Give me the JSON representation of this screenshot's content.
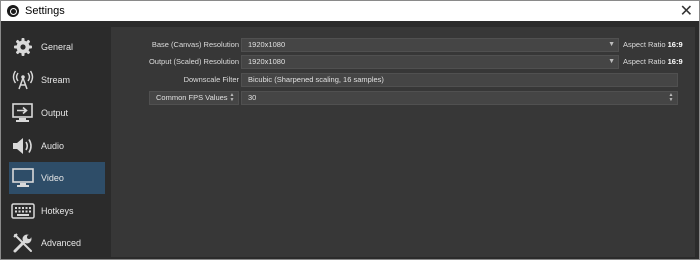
{
  "window": {
    "title": "Settings",
    "close_glyph": "✕"
  },
  "sidebar": {
    "items": [
      {
        "label": "General",
        "icon": "gear-icon",
        "active": false
      },
      {
        "label": "Stream",
        "icon": "antenna-icon",
        "active": false
      },
      {
        "label": "Output",
        "icon": "output-icon",
        "active": false
      },
      {
        "label": "Audio",
        "icon": "speaker-icon",
        "active": false
      },
      {
        "label": "Video",
        "icon": "monitor-icon",
        "active": true
      },
      {
        "label": "Hotkeys",
        "icon": "keyboard-icon",
        "active": false
      },
      {
        "label": "Advanced",
        "icon": "wrench-icon",
        "active": false
      }
    ]
  },
  "video": {
    "base_resolution": {
      "label": "Base (Canvas) Resolution",
      "value": "1920x1080",
      "aspect_label": "Aspect Ratio",
      "aspect_value": "16:9"
    },
    "output_resolution": {
      "label": "Output (Scaled) Resolution",
      "value": "1920x1080",
      "aspect_label": "Aspect Ratio",
      "aspect_value": "16:9"
    },
    "downscale_filter": {
      "label": "Downscale Filter",
      "value": "Bicubic (Sharpened scaling, 16 samples)"
    },
    "fps": {
      "type_value": "Common FPS Values",
      "value": "30"
    }
  },
  "colors": {
    "background": "#2b2b2b",
    "panel": "#373737",
    "field": "#454545",
    "active_nav": "#2e4d68"
  }
}
